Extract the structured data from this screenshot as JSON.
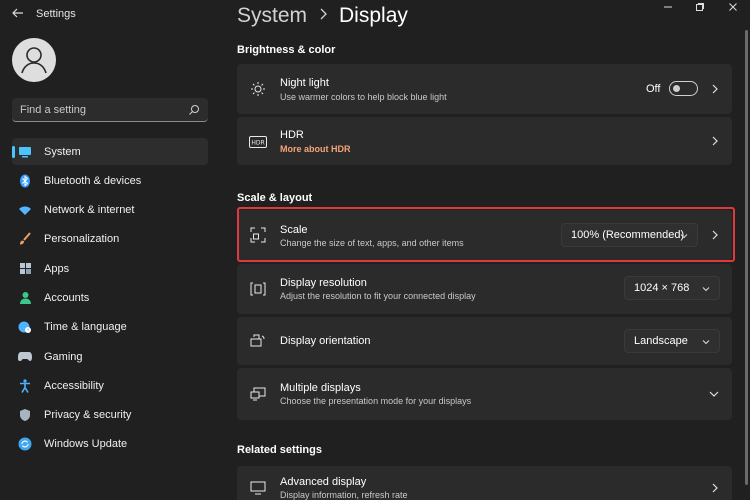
{
  "window": {
    "app_title": "Settings"
  },
  "search": {
    "placeholder": "Find a setting"
  },
  "sidebar": {
    "items": [
      {
        "label": "System",
        "icon": "monitor-icon",
        "color": "#4cc2ff"
      },
      {
        "label": "Bluetooth & devices",
        "icon": "bluetooth-icon",
        "color": "#3aa0ff"
      },
      {
        "label": "Network & internet",
        "icon": "wifi-icon",
        "color": "#56b5ff"
      },
      {
        "label": "Personalization",
        "icon": "brush-icon",
        "color": "#f0a060"
      },
      {
        "label": "Apps",
        "icon": "apps-icon",
        "color": "#b9c6d6"
      },
      {
        "label": "Accounts",
        "icon": "person-icon",
        "color": "#3ec58a"
      },
      {
        "label": "Time & language",
        "icon": "globe-clock-icon",
        "color": "#4fb3ff"
      },
      {
        "label": "Gaming",
        "icon": "controller-icon",
        "color": "#bfc7d2"
      },
      {
        "label": "Accessibility",
        "icon": "accessibility-icon",
        "color": "#4cb4ff"
      },
      {
        "label": "Privacy & security",
        "icon": "shield-icon",
        "color": "#a8b4c0"
      },
      {
        "label": "Windows Update",
        "icon": "update-icon",
        "color": "#3da8f0"
      }
    ]
  },
  "breadcrumb": {
    "parent": "System",
    "current": "Display"
  },
  "sections": {
    "brightness": "Brightness & color",
    "scale_layout": "Scale & layout",
    "related": "Related settings"
  },
  "night_light": {
    "title": "Night light",
    "subtitle": "Use warmer colors to help block blue light",
    "state": "Off"
  },
  "hdr": {
    "title": "HDR",
    "link": "More about HDR"
  },
  "scale": {
    "title": "Scale",
    "subtitle": "Change the size of text, apps, and other items",
    "value": "100% (Recommended)"
  },
  "resolution": {
    "title": "Display resolution",
    "subtitle": "Adjust the resolution to fit your connected display",
    "value": "1024 × 768"
  },
  "orientation": {
    "title": "Display orientation",
    "value": "Landscape"
  },
  "multiple": {
    "title": "Multiple displays",
    "subtitle": "Choose the presentation mode for your displays"
  },
  "advanced": {
    "title": "Advanced display",
    "subtitle": "Display information, refresh rate"
  },
  "colors": {
    "accent": "#4cc2ff",
    "highlight": "#e0393b",
    "link": "#f5a47a"
  }
}
